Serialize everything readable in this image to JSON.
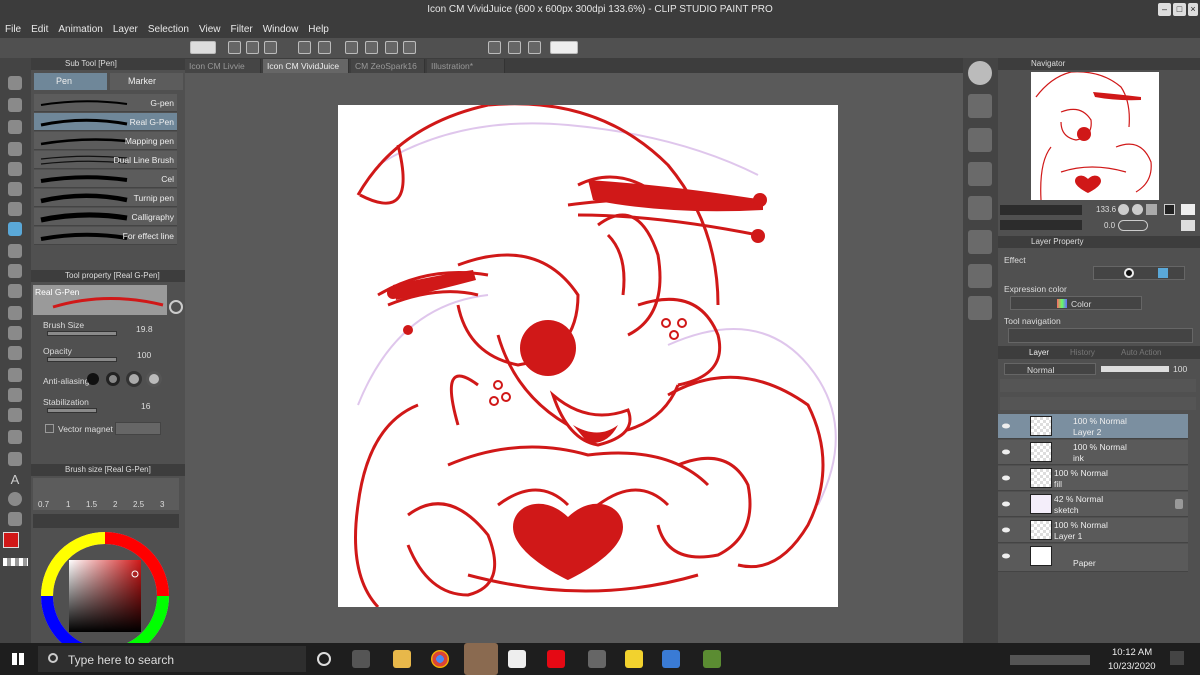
{
  "window": {
    "title": "Icon CM VividJuice (600 x 600px 300dpi 133.6%) - CLIP STUDIO PAINT PRO"
  },
  "menu": [
    "File",
    "Edit",
    "Animation",
    "Layer",
    "Selection",
    "View",
    "Filter",
    "Window",
    "Help"
  ],
  "subtool": {
    "header": "Sub Tool [Pen]",
    "tabs": [
      "Pen",
      "Marker"
    ],
    "brushes": [
      "G-pen",
      "Real G-Pen",
      "Mapping pen",
      "Dual Line Brush",
      "Cel",
      "Turnip pen",
      "Calligraphy",
      "For effect line"
    ]
  },
  "toolprop": {
    "header": "Tool property [Real G-Pen]",
    "preset": "Real G-Pen",
    "brush_size_label": "Brush Size",
    "brush_size": "19.8",
    "opacity_label": "Opacity",
    "opacity": "100",
    "antialias_label": "Anti-aliasing",
    "stabilization_label": "Stabilization",
    "stabilization": "16",
    "vector_magnet_label": "Vector magnet"
  },
  "brushsize": {
    "header": "Brush size [Real G-Pen]",
    "sizes": [
      "0.7",
      "1",
      "1.5",
      "2",
      "2.5",
      "3"
    ]
  },
  "doc_tabs": [
    "Icon CM Livvie",
    "Icon CM VividJuice",
    "CM ZeoSpark16",
    "Illustration*"
  ],
  "navigator": {
    "title": "Navigator",
    "zoom": "133.6",
    "rotation": "0.0"
  },
  "layer_property": {
    "title": "Layer Property",
    "effect_label": "Effect",
    "expression_label": "Expression color",
    "expression_value": "Color",
    "tool_nav_label": "Tool navigation"
  },
  "layers_panel": {
    "tabs": [
      "Layer",
      "History",
      "Auto Action"
    ],
    "blend": "Normal",
    "opacity": "100",
    "layers": [
      {
        "line1": "100 % Normal",
        "line2": "Layer 2"
      },
      {
        "line1": "100 % Normal",
        "line2": "ink"
      },
      {
        "line1": "100 % Normal",
        "line2": "fill"
      },
      {
        "line1": "42 % Normal",
        "line2": "sketch"
      },
      {
        "line1": "100 % Normal",
        "line2": "Layer 1"
      },
      {
        "line1": "",
        "line2": "Paper"
      }
    ]
  },
  "taskbar": {
    "search": "Type here to search",
    "time": "10:12 AM",
    "date": "10/23/2020"
  },
  "colors": {
    "accent": "#d01818",
    "selection": "#5aa8d8"
  }
}
